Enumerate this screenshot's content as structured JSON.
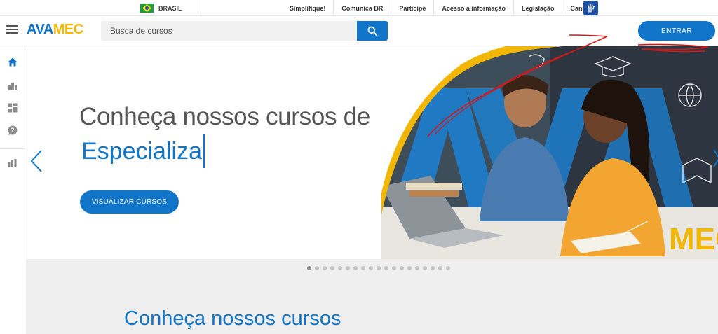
{
  "govbar": {
    "country": "BRASIL",
    "links": [
      "Simplifique!",
      "Comunica BR",
      "Participe",
      "Acesso à informação",
      "Legislação",
      "Canais"
    ]
  },
  "header": {
    "logo_part1": "AVA",
    "logo_part2": "MEC",
    "search_placeholder": "Busca de cursos",
    "login_label": "ENTRAR"
  },
  "sidebar": {
    "icons": [
      "home-icon",
      "institutions-icon",
      "catalog-icon",
      "help-icon",
      "stats-icon"
    ]
  },
  "hero": {
    "title": "Conheça nossos cursos de",
    "typed_text": "Especializa",
    "button_label": "VISUALIZAR CURSOS",
    "art_text": "MEC"
  },
  "carousel": {
    "slide_count": 19,
    "active_index": 0
  },
  "section": {
    "title": "Conheça nossos cursos"
  },
  "colors": {
    "primary": "#1075c8",
    "accent": "#f2b705",
    "band": "#efefef"
  }
}
